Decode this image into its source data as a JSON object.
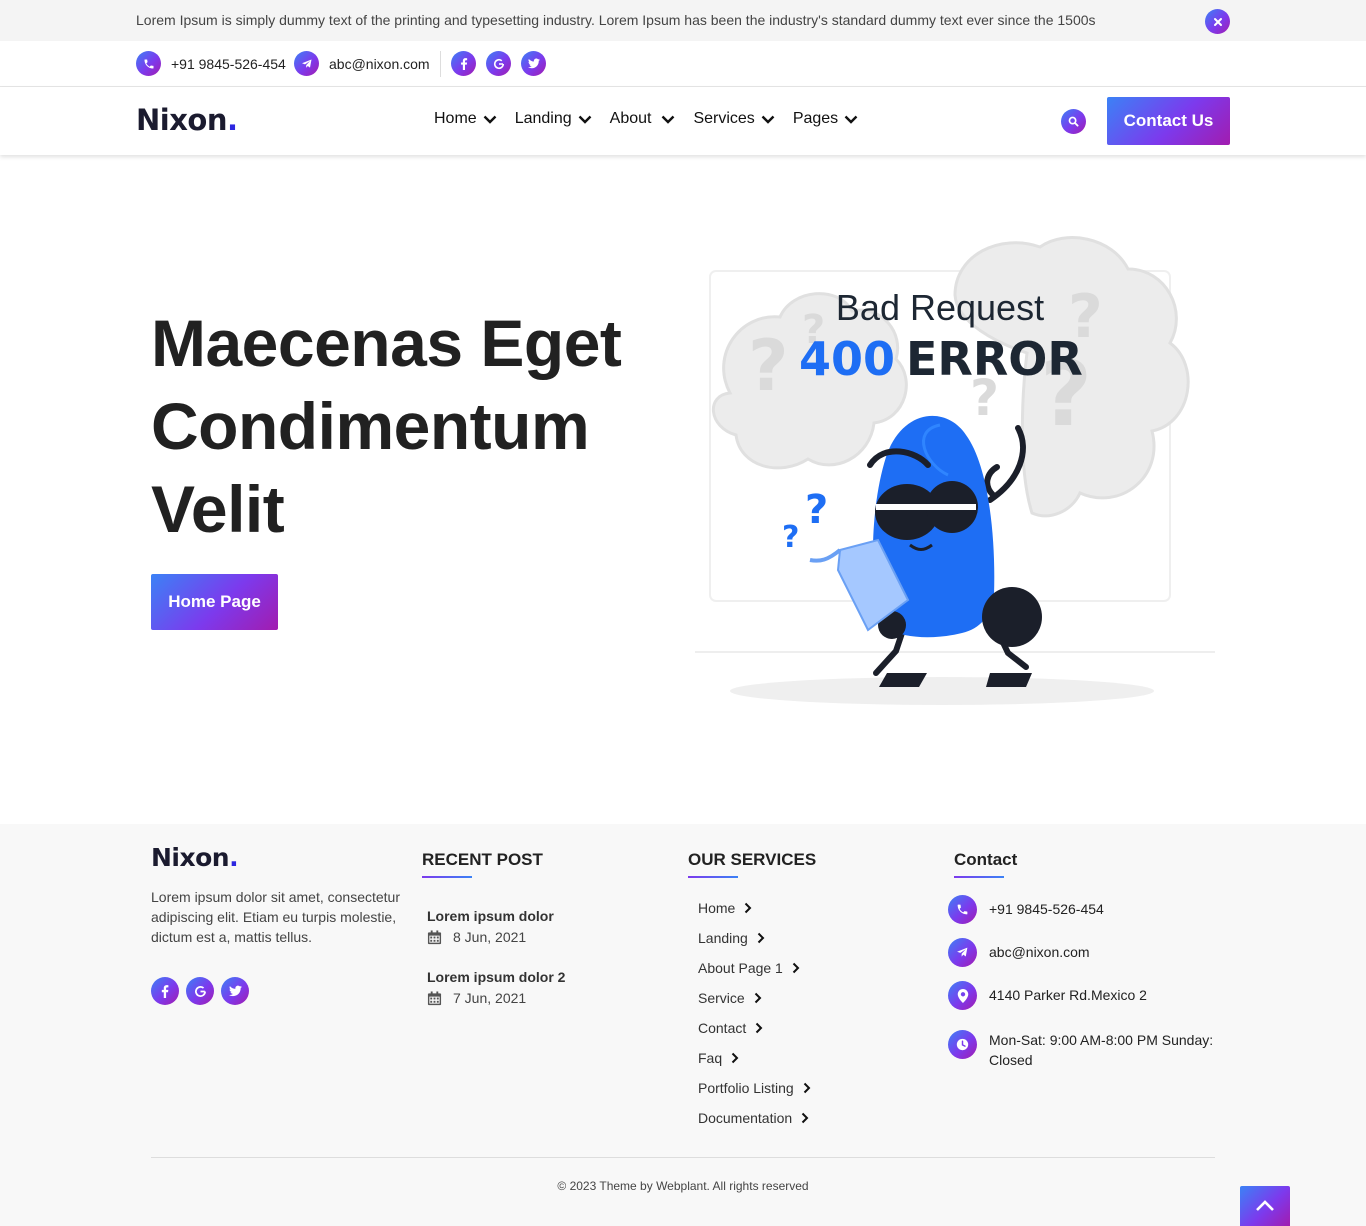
{
  "announcement": {
    "text": "Lorem Ipsum is simply dummy text of the printing and typesetting industry. Lorem Ipsum has been the industry's standard dummy text ever since the 1500s",
    "close_icon": "close-icon"
  },
  "topbar": {
    "phone": "+91 9845-526-454",
    "email": "abc@nixon.com",
    "social": [
      "facebook-icon",
      "google-icon",
      "twitter-icon"
    ]
  },
  "brand": {
    "name": "Nixon",
    "dot": "."
  },
  "nav": {
    "items": [
      {
        "label": "Home"
      },
      {
        "label": "Landing"
      },
      {
        "label": "About"
      },
      {
        "label": "Services"
      },
      {
        "label": "Pages"
      }
    ],
    "cta": "Contact Us"
  },
  "hero": {
    "title_lines": [
      "Maecenas Eget",
      "Condimentum",
      "Velit"
    ],
    "button": "Home Page"
  },
  "illustration": {
    "line1": "Bad Request",
    "code": "400",
    "word": "ERROR"
  },
  "footer": {
    "about": "Lorem ipsum dolor sit amet, consectetur adipiscing elit. Etiam eu turpis molestie, dictum est a, mattis tellus.",
    "recent_post": {
      "heading": "RECENT POST",
      "posts": [
        {
          "title": "Lorem ipsum dolor",
          "date": "8 Jun, 2021"
        },
        {
          "title": "Lorem ipsum dolor 2",
          "date": "7 Jun, 2021"
        }
      ]
    },
    "services": {
      "heading": "OUR SERVICES",
      "items": [
        "Home",
        "Landing",
        "About Page 1",
        "Service",
        "Contact",
        "Faq",
        "Portfolio Listing",
        "Documentation"
      ]
    },
    "contact": {
      "heading": "Contact",
      "phone": "+91 9845-526-454",
      "email": "abc@nixon.com",
      "address": "4140 Parker Rd.Mexico 2",
      "hours": "Mon-Sat: 9:00 AM-8:00 PM Sunday: Closed"
    },
    "copyright": "© 2023 Theme by Webplant. All rights reserved"
  },
  "colors": {
    "accent_start": "#3b82f6",
    "accent_end": "#a21caf",
    "character": "#1e6ef4"
  }
}
